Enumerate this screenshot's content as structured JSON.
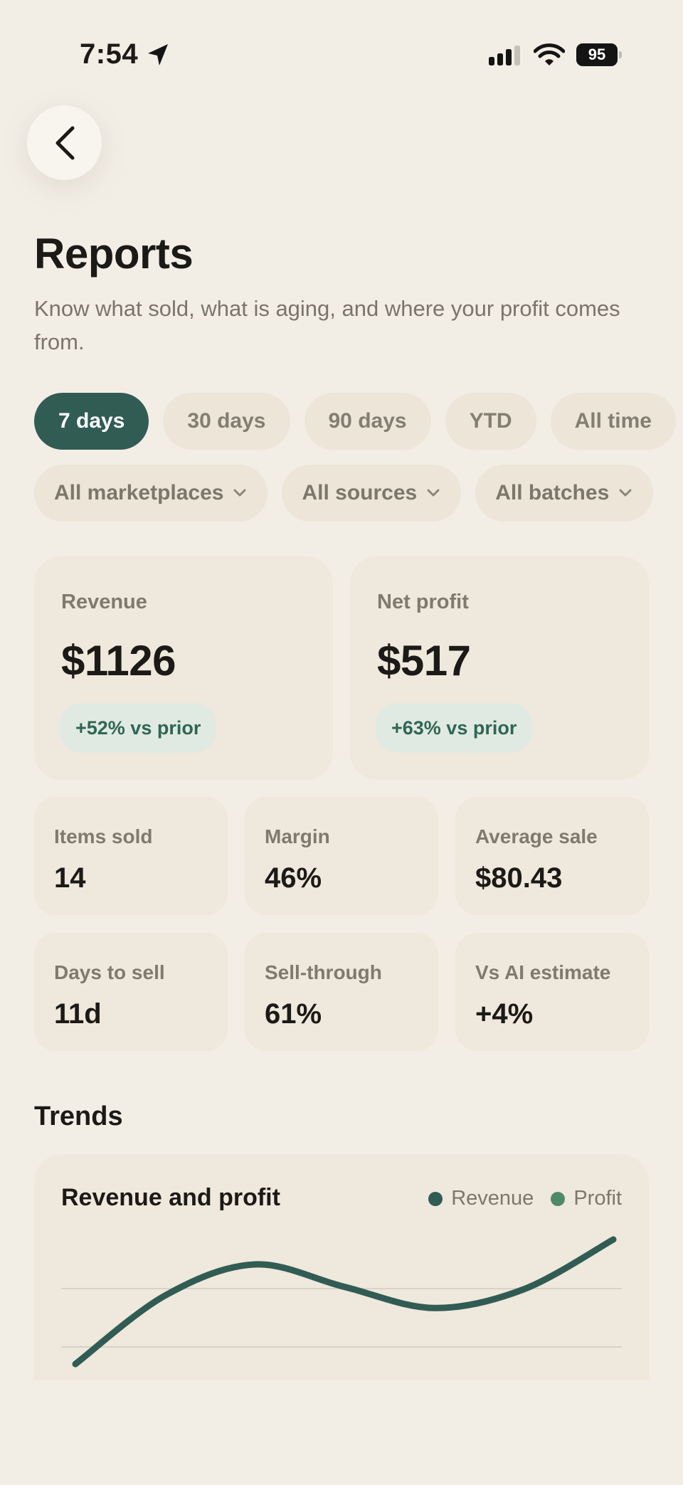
{
  "status_bar": {
    "time": "7:54",
    "battery": "95"
  },
  "header": {
    "title": "Reports",
    "subtitle": "Know what sold, what is aging, and where your profit comes from."
  },
  "periods": [
    {
      "label": "7 days",
      "active": true
    },
    {
      "label": "30 days",
      "active": false
    },
    {
      "label": "90 days",
      "active": false
    },
    {
      "label": "YTD",
      "active": false
    },
    {
      "label": "All time",
      "active": false
    }
  ],
  "filters": [
    {
      "label": "All marketplaces"
    },
    {
      "label": "All sources"
    },
    {
      "label": "All batches"
    }
  ],
  "summary": {
    "revenue": {
      "label": "Revenue",
      "value": "$1126",
      "delta": "+52% vs prior"
    },
    "net_profit": {
      "label": "Net profit",
      "value": "$517",
      "delta": "+63% vs prior"
    }
  },
  "stats": [
    {
      "label": "Items sold",
      "value": "14"
    },
    {
      "label": "Margin",
      "value": "46%"
    },
    {
      "label": "Average sale",
      "value": "$80.43"
    },
    {
      "label": "Days to sell",
      "value": "11d"
    },
    {
      "label": "Sell-through",
      "value": "61%"
    },
    {
      "label": "Vs AI estimate",
      "value": "+4%"
    }
  ],
  "trends": {
    "section_title": "Trends",
    "chart_title": "Revenue and profit",
    "legend": [
      {
        "label": "Revenue",
        "color": "#315c54"
      },
      {
        "label": "Profit",
        "color": "#4e8a68"
      }
    ]
  },
  "chart_data": {
    "type": "line",
    "title": "Revenue and profit",
    "xlabel": "",
    "ylabel": "",
    "grid": true,
    "legend_position": "top-right",
    "series": [
      {
        "name": "Revenue",
        "color": "#315c54",
        "values": [
          0.0,
          0.55,
          0.8,
          0.62,
          0.45,
          0.6,
          1.0
        ]
      }
    ]
  },
  "colors": {
    "background": "#f2eee6",
    "card": "#efe8dc",
    "accent": "#315c54",
    "positive": "#2f6656"
  }
}
